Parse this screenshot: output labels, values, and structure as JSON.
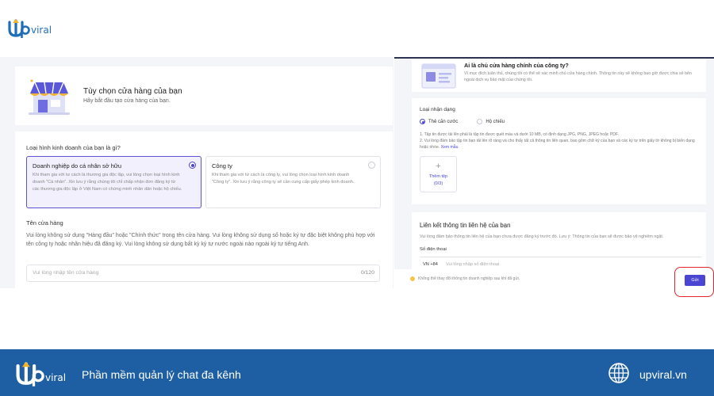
{
  "brand": {
    "name": "viral"
  },
  "left": {
    "header": {
      "title": "Tùy chọn cửa hàng của bạn",
      "subtitle": "Hãy bắt đầu tạo cửa hàng của bạn."
    },
    "business_type": {
      "question": "Loại hình kinh doanh của bạn là gì?",
      "options": [
        {
          "title": "Doanh nghiệp do cá nhân sở hữu",
          "desc": "Khi tham gia với tư cách là thương gia độc lập, vui lòng chọn loại hình kinh doanh \"Cá nhân\". Xin lưu ý rằng chúng tôi chỉ chấp nhận đơn đăng ký từ các thương gia độc lập ở Việt Nam có chứng minh nhân dân hoặc hộ chiếu.",
          "selected": true
        },
        {
          "title": "Công ty",
          "desc": "Khi tham gia với tư cách là công ty, vui lòng chọn loại hình kinh doanh \"Công ty\". Xin lưu ý rằng công ty sẽ cần cung cấp giấy phép kinh doanh.",
          "selected": false
        }
      ]
    },
    "store_name": {
      "label": "Tên cửa hàng",
      "help": "Vui lòng không sử dụng \"Hàng đầu\" hoặc \"Chính thức\" trong tên cửa hàng. Vui lòng không sử dụng số hoặc ký tự đặc biệt không phù hợp với tên công ty hoặc nhãn hiệu đã đăng ký. Vui lòng không sử dụng bất kỳ ký tự nước ngoài nào ngoài ký tự tiếng Anh.",
      "placeholder": "Vui lòng nhập tên cửa hàng",
      "counter": "0/120"
    }
  },
  "right": {
    "owner": {
      "title": "Ai là chủ cửa hàng chính của công ty?",
      "desc": "Vì mục đích tuân thủ, chúng tôi có thể sẽ xác minh chủ cửa hàng chính. Thông tin này sẽ không bao giờ được chia sẻ bên ngoài dịch vụ bảo mật của chúng tôi."
    },
    "id_type": {
      "label": "Loại nhận dạng",
      "options": [
        {
          "label": "Thẻ căn cước",
          "selected": true
        },
        {
          "label": "Hộ chiếu",
          "selected": false
        }
      ],
      "note1": "1. Tập tin được tải lên phải là tập tin được quét màu và dưới 10 MB, có định dạng JPG, PNG, JPEG hoặc PDF.",
      "note2": "2. Vui lòng đảm bảo tập tin bạn tải lên rõ ràng và cho thấy tất cả thông tin liên quan, bao gồm chữ ký của bạn và các ký tự trên giấy tờ không bị biến dạng hoặc nhòe.",
      "note_link": "Xem mẫu",
      "upload_label": "Thêm tệp",
      "upload_count": "(0/3)"
    },
    "contact": {
      "title": "Liên kết thông tin liên hệ của bạn",
      "desc": "Vui lòng đảm bảo thông tin liên hệ của bạn chưa được đăng ký trước đó. Lưu ý: Thông tin của bạn sẽ được bảo vệ nghiêm ngặt.",
      "phone_label": "Số điện thoại",
      "phone_prefix": "VN +84",
      "phone_placeholder": "Vui lòng nhập số điện thoại"
    },
    "warning": "Không thể thay đổi thông tin doanh nghiệp sau khi đã gửi.",
    "submit_label": "Gửi"
  },
  "footer": {
    "tagline": "Phần mềm quản lý chat đa kênh",
    "website": "upviral.vn"
  },
  "colors": {
    "accent": "#4b45d3",
    "footer": "#1e5fa3",
    "highlight": "#e0252b"
  }
}
